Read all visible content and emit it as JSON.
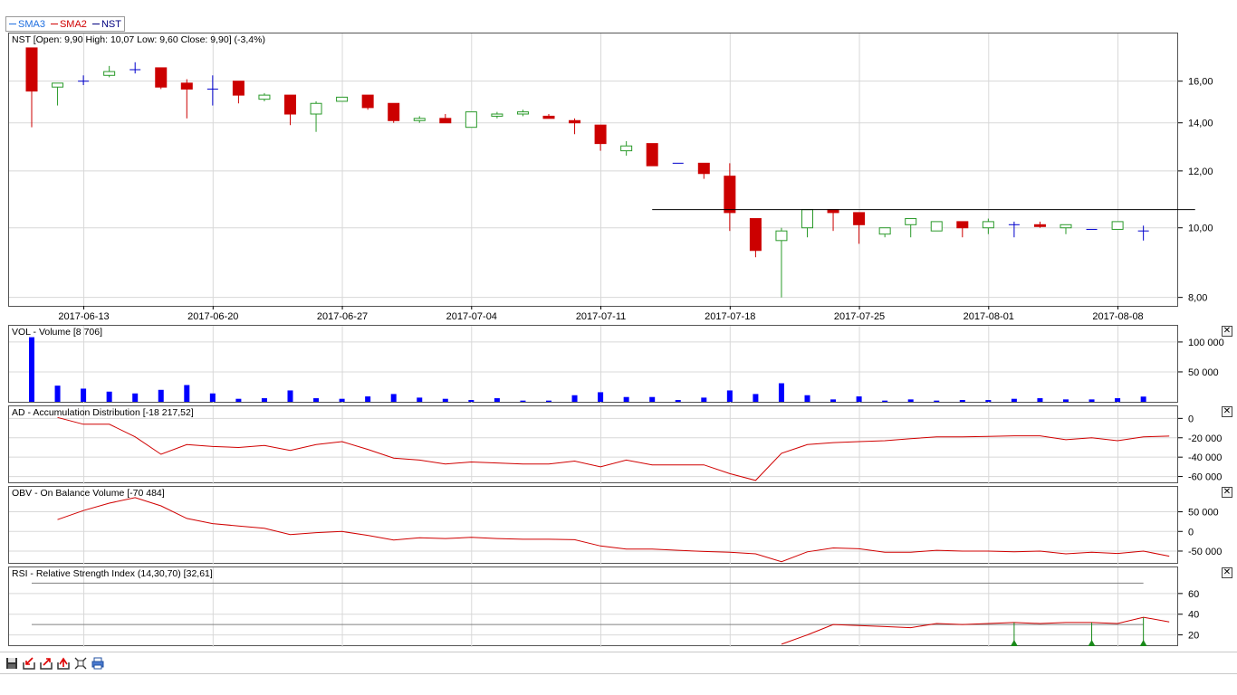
{
  "legend": [
    {
      "name": "SMA3",
      "color": "#1f6fe0"
    },
    {
      "name": "SMA2",
      "color": "#d00000"
    },
    {
      "name": "NST",
      "color": "#000080"
    }
  ],
  "colors": {
    "up": "#2a9a2a",
    "down": "#cc0000",
    "flat": "#0000cc",
    "volume": "#0000ff",
    "indicator": "#d00000",
    "grid": "#d8d8d8",
    "rsi_arrow": "#1a8a1a"
  },
  "chart_data": [
    {
      "type": "candlestick",
      "title": "NST [Open: 9,90  High: 10,07  Low: 9,60  Close: 9,90] (-3,4%)",
      "scale": "log",
      "ylim": [
        7.9,
        17.9
      ],
      "y_ticks": [
        "16,00",
        "14,00",
        "12,00",
        "10,00",
        "8,00"
      ],
      "y_tick_values": [
        16,
        14,
        12,
        10,
        8
      ],
      "x_tick_labels": [
        "2017-06-13",
        "2017-06-20",
        "2017-06-27",
        "2017-07-04",
        "2017-07-11",
        "2017-07-18",
        "2017-07-25",
        "2017-08-01",
        "2017-08-08"
      ],
      "x_tick_indices": [
        1,
        6,
        11,
        16,
        21,
        26,
        31,
        36,
        41
      ],
      "horizontal_line": {
        "y": 10.6,
        "from_index": 24,
        "to_index": 45
      },
      "candles": [
        [
          17.8,
          17.8,
          13.8,
          15.5
        ],
        [
          15.7,
          15.9,
          14.8,
          15.9
        ],
        [
          16.0,
          16.3,
          15.8,
          16.0
        ],
        [
          16.3,
          16.8,
          16.2,
          16.5
        ],
        [
          16.6,
          17.0,
          16.4,
          16.6
        ],
        [
          16.7,
          16.7,
          15.6,
          15.7
        ],
        [
          15.9,
          16.1,
          14.2,
          15.6
        ],
        [
          15.6,
          16.3,
          14.8,
          15.6
        ],
        [
          16.0,
          16.0,
          14.9,
          15.3
        ],
        [
          15.1,
          15.4,
          15.0,
          15.3
        ],
        [
          15.3,
          15.3,
          13.9,
          14.4
        ],
        [
          14.4,
          15.0,
          13.6,
          14.9
        ],
        [
          15.0,
          15.2,
          15.0,
          15.2
        ],
        [
          15.3,
          15.3,
          14.6,
          14.7
        ],
        [
          14.9,
          14.9,
          14.0,
          14.1
        ],
        [
          14.1,
          14.3,
          14.0,
          14.2
        ],
        [
          14.2,
          14.4,
          14.0,
          14.0
        ],
        [
          13.8,
          14.5,
          13.8,
          14.5
        ],
        [
          14.3,
          14.5,
          14.2,
          14.4
        ],
        [
          14.4,
          14.6,
          14.3,
          14.5
        ],
        [
          14.3,
          14.4,
          14.2,
          14.2
        ],
        [
          14.1,
          14.2,
          13.5,
          14.0
        ],
        [
          13.9,
          13.9,
          12.8,
          13.1
        ],
        [
          12.8,
          13.2,
          12.6,
          13.0
        ],
        [
          13.1,
          13.1,
          12.2,
          12.2
        ],
        [
          12.3,
          12.3,
          12.3,
          12.3
        ],
        [
          12.3,
          12.3,
          11.7,
          11.9
        ],
        [
          11.8,
          12.3,
          9.9,
          10.5
        ],
        [
          10.3,
          10.3,
          9.1,
          9.3
        ],
        [
          9.6,
          10.0,
          8.0,
          9.9
        ],
        [
          10.0,
          10.6,
          9.7,
          10.6
        ],
        [
          10.6,
          10.6,
          9.9,
          10.5
        ],
        [
          10.5,
          10.5,
          9.5,
          10.1
        ],
        [
          9.8,
          10.0,
          9.7,
          10.0
        ],
        [
          10.1,
          10.3,
          9.7,
          10.3
        ],
        [
          9.9,
          10.2,
          9.9,
          10.2
        ],
        [
          10.2,
          10.2,
          9.7,
          10.0
        ],
        [
          10.0,
          10.3,
          9.8,
          10.2
        ],
        [
          10.1,
          10.2,
          9.7,
          10.1
        ],
        [
          10.1,
          10.2,
          10.0,
          10.05
        ],
        [
          10.0,
          10.1,
          9.8,
          10.1
        ],
        [
          9.95,
          9.95,
          9.95,
          9.95
        ],
        [
          9.95,
          10.2,
          9.95,
          10.2
        ],
        [
          9.9,
          10.07,
          9.6,
          9.9
        ]
      ]
    },
    {
      "type": "bar",
      "title": "VOL - Volume [8 706]",
      "ylim": [
        0,
        115000
      ],
      "y_ticks": [
        "100 000",
        "50 000"
      ],
      "y_tick_values": [
        100000,
        50000
      ],
      "values": [
        108000,
        27000,
        22000,
        17000,
        14000,
        20000,
        28000,
        14000,
        5000,
        6000,
        19000,
        6000,
        5000,
        9000,
        13000,
        7000,
        5000,
        3000,
        6000,
        2000,
        2000,
        11000,
        16000,
        8000,
        8000,
        3000,
        7000,
        19000,
        13000,
        31000,
        11000,
        4000,
        9000,
        2000,
        4000,
        2000,
        3000,
        3000,
        5000,
        6000,
        4000,
        4000,
        6000,
        8706
      ]
    },
    {
      "type": "line",
      "title": "AD - Accumulation Distribution [-18 217,52]",
      "ylim": [
        -66000,
        5000
      ],
      "y_ticks": [
        "0",
        "-20 000",
        "-40 000",
        "-60 000"
      ],
      "y_tick_values": [
        0,
        -20000,
        -40000,
        -60000
      ],
      "start_index": 1,
      "values": [
        1000,
        -6000,
        -6000,
        -19000,
        -37000,
        -27000,
        -29000,
        -30000,
        -28000,
        -33000,
        -27000,
        -24000,
        -32000,
        -41000,
        -43000,
        -47000,
        -45000,
        -46000,
        -47000,
        -47000,
        -44000,
        -50000,
        -43000,
        -48000,
        -48000,
        -48000,
        -57000,
        -64000,
        -36000,
        -27000,
        -25000,
        -24000,
        -23000,
        -21000,
        -19000,
        -19000,
        -18500,
        -18000,
        -18000,
        -22000,
        -20000,
        -23000,
        -19000,
        -18217
      ]
    },
    {
      "type": "line",
      "title": "OBV - On Balance Volume [-70 484]",
      "ylim": [
        -80000,
        95000
      ],
      "y_ticks": [
        "50 000",
        "0",
        "-50 000"
      ],
      "y_tick_values": [
        50000,
        0,
        -50000
      ],
      "start_index": 1,
      "values": [
        30000,
        53000,
        72000,
        86000,
        65000,
        33000,
        20000,
        14000,
        8000,
        -8000,
        -3000,
        0,
        -10000,
        -22000,
        -16000,
        -18000,
        -15000,
        -18000,
        -20000,
        -20000,
        -21000,
        -37000,
        -45000,
        -45000,
        -48000,
        -51000,
        -53000,
        -57000,
        -77000,
        -52000,
        -42000,
        -44000,
        -53000,
        -53000,
        -48000,
        -50000,
        -50000,
        -52000,
        -50000,
        -57000,
        -53000,
        -56000,
        -50000,
        -63000
      ]
    },
    {
      "type": "line",
      "title": "RSI - Relative Strength Index (14,30,70) [32,61]",
      "ylim": [
        10,
        80
      ],
      "y_ticks": [
        "60",
        "40",
        "20"
      ],
      "y_tick_values": [
        60,
        40,
        20
      ],
      "levels": [
        30,
        70
      ],
      "start_index": 29,
      "values": [
        11,
        20,
        30,
        29,
        28,
        27,
        31,
        30,
        31,
        32,
        31,
        32,
        32,
        31,
        37,
        32.61
      ],
      "signal_indices": [
        38,
        41,
        43
      ]
    }
  ],
  "toolbar": [
    {
      "name": "save-icon"
    },
    {
      "name": "import-icon"
    },
    {
      "name": "export-icon"
    },
    {
      "name": "export-all-icon"
    },
    {
      "name": "fit-screen-icon"
    },
    {
      "name": "print-icon"
    }
  ]
}
